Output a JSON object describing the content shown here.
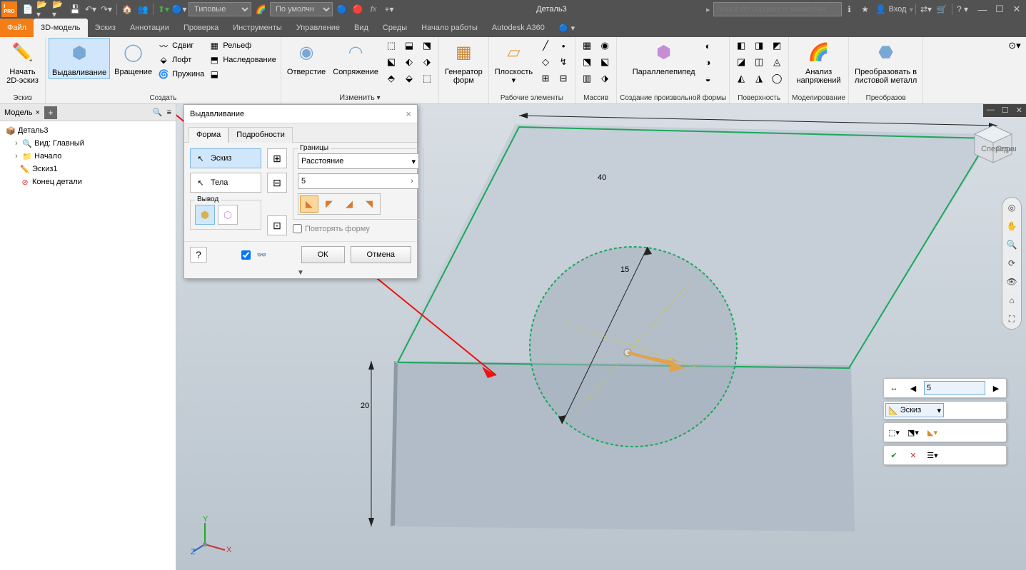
{
  "title": "Деталь3",
  "search_placeholder": "Поиск по справке и командам.",
  "login": "Вход",
  "qat_select1": "Типовые",
  "qat_select2": "По умолчн",
  "file_tab": "Файл",
  "main_tabs": [
    "3D-модель",
    "Эскиз",
    "Аннотации",
    "Проверка",
    "Инструменты",
    "Управление",
    "Вид",
    "Среды",
    "Начало работы",
    "Autodesk A360"
  ],
  "active_main_tab": 0,
  "ribbon": {
    "sketch": {
      "big": "Начать\n2D-эскиз",
      "label": "Эскиз"
    },
    "create": {
      "extrude": "Выдавливание",
      "revolve": "Вращение",
      "small": [
        "Сдвиг",
        "Лофт",
        "Пружина",
        "Рельеф",
        "Наследование"
      ],
      "label": "Создать"
    },
    "modify": {
      "hole": "Отверстие",
      "fillet": "Сопряжение",
      "label": "Изменить"
    },
    "form": {
      "gen": "Генератор\nформ"
    },
    "work": {
      "plane": "Плоскость",
      "label": "Рабочие элементы"
    },
    "array": {
      "label": "Массив"
    },
    "freeform": {
      "box": "Параллелепипед",
      "label": "Создание произвольной формы"
    },
    "surface": {
      "label": "Поверхность"
    },
    "stress": {
      "name": "Анализ\nнапряжений",
      "label": "Моделирование"
    },
    "sheet": {
      "name": "Преобразовать в\nлистовой металл",
      "label": "Преобразов"
    }
  },
  "browser": {
    "tab": "Модель",
    "root": "Деталь3",
    "nodes": [
      "Вид: Главный",
      "Начало",
      "Эскиз1",
      "Конец детали"
    ]
  },
  "dlg": {
    "title": "Выдавливание",
    "tabs": [
      "Форма",
      "Подробности"
    ],
    "active_tab": 0,
    "sketch": "Эскиз",
    "solids": "Тела",
    "output": "Вывод",
    "extents": "Границы",
    "extents_mode": "Расстояние",
    "value": "5",
    "repeat": "Повторять форму",
    "ok": "ОК",
    "cancel": "Отмена"
  },
  "dims": {
    "w": "40",
    "h": "20",
    "d": "15"
  },
  "mini": {
    "val": "5",
    "profile": "Эскиз"
  },
  "viewcube": {
    "front": "Спереди",
    "right": "Справа"
  }
}
